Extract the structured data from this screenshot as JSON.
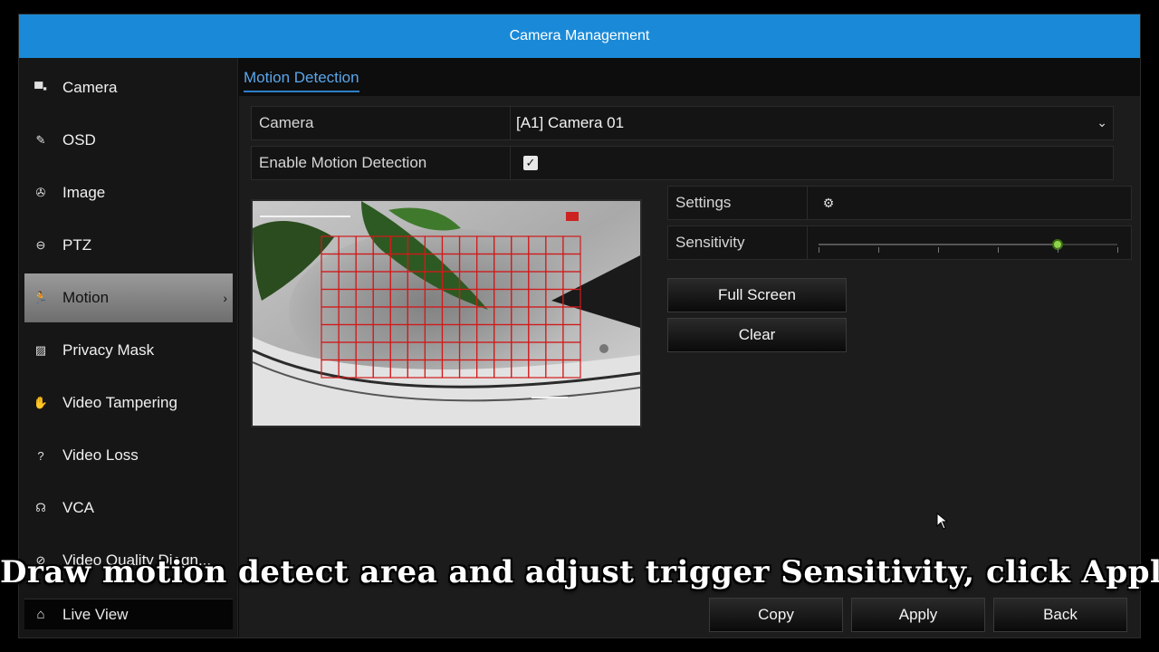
{
  "window": {
    "title": "Camera Management"
  },
  "sidebar": {
    "items": [
      {
        "label": "Camera",
        "icon": "camera-icon",
        "glyph": "▀▪"
      },
      {
        "label": "OSD",
        "icon": "pen-icon",
        "glyph": "✎"
      },
      {
        "label": "Image",
        "icon": "aperture-icon",
        "glyph": "✇"
      },
      {
        "label": "PTZ",
        "icon": "ptz-icon",
        "glyph": "⊖"
      },
      {
        "label": "Motion",
        "icon": "running-person-icon",
        "glyph": "🏃",
        "active": true
      },
      {
        "label": "Privacy Mask",
        "icon": "mask-icon",
        "glyph": "▨"
      },
      {
        "label": "Video Tampering",
        "icon": "hand-icon",
        "glyph": "✋"
      },
      {
        "label": "Video Loss",
        "icon": "question-box-icon",
        "glyph": "?"
      },
      {
        "label": "VCA",
        "icon": "head-icon",
        "glyph": "☊"
      },
      {
        "label": "Video Quality Diagn...",
        "icon": "diagnosis-icon",
        "glyph": "⊘"
      }
    ],
    "live_view": {
      "label": "Live View",
      "icon": "home-icon",
      "glyph": "⌂"
    }
  },
  "tabs": [
    {
      "label": "Motion Detection",
      "active": true
    }
  ],
  "form": {
    "camera": {
      "label": "Camera",
      "value": "[A1] Camera 01"
    },
    "enable": {
      "label": "Enable Motion Detection",
      "checked": true
    },
    "settings": {
      "label": "Settings",
      "icon": "gear-icon"
    },
    "sensitivity": {
      "label": "Sensitivity",
      "level": 0.8,
      "ticks": 6
    }
  },
  "buttons": {
    "full_screen": "Full Screen",
    "clear": "Clear",
    "copy": "Copy",
    "apply": "Apply",
    "back": "Back"
  },
  "grid": {
    "cols": 15,
    "rows": 8,
    "color": "#d11a1a"
  },
  "caption": "Draw motion detect area and adjust trigger Sensitivity, click Apply",
  "colors": {
    "accent": "#1a8ad8",
    "tab_text": "#5aa6ea",
    "grid": "#d11a1a",
    "knob": "#8fd34a"
  }
}
